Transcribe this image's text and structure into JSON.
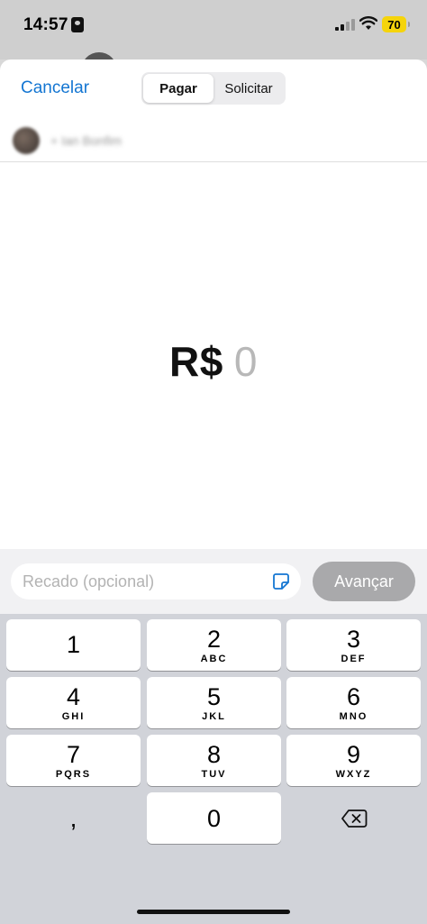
{
  "status_bar": {
    "time": "14:57",
    "battery": "70",
    "icons": [
      "id-card-icon",
      "signal-icon",
      "wifi-icon",
      "battery-icon"
    ]
  },
  "header": {
    "cancel_label": "Cancelar",
    "tabs": [
      {
        "label": "Pagar",
        "active": true
      },
      {
        "label": "Solicitar",
        "active": false
      }
    ]
  },
  "recipient": {
    "name": "+ Ian Bonfim"
  },
  "amount": {
    "currency": "R$",
    "value": "0"
  },
  "memo": {
    "placeholder": "Recado (opcional)",
    "icon": "sticker-icon"
  },
  "advance_label": "Avançar",
  "keypad": {
    "keys": [
      {
        "num": "1",
        "letters": ""
      },
      {
        "num": "2",
        "letters": "ABC"
      },
      {
        "num": "3",
        "letters": "DEF"
      },
      {
        "num": "4",
        "letters": "GHI"
      },
      {
        "num": "5",
        "letters": "JKL"
      },
      {
        "num": "6",
        "letters": "MNO"
      },
      {
        "num": "7",
        "letters": "PQRS"
      },
      {
        "num": "8",
        "letters": "TUV"
      },
      {
        "num": "9",
        "letters": "WXYZ"
      },
      {
        "num": ",",
        "letters": ""
      },
      {
        "num": "0",
        "letters": ""
      }
    ],
    "delete_icon": "backspace-icon"
  },
  "colors": {
    "accent": "#1476d2",
    "button_disabled": "#a9a9ab",
    "keypad_bg": "#d1d3d9",
    "battery": "#f5d40b"
  }
}
